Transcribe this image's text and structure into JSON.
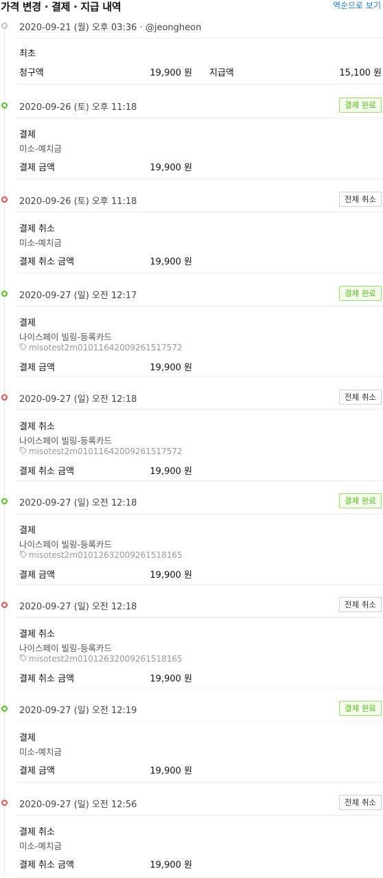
{
  "header": {
    "title": "가격 변경 · 결제 · 지급 내역",
    "reverse_label": "역순으로 보기"
  },
  "events": [
    {
      "status": "neutral",
      "date": "2020-09-21 (월) 오후 03:36 · @jeongheon",
      "type": "최초",
      "charge_label": "청구액",
      "charge_value": "19,900 원",
      "paid_label": "지급액",
      "paid_value": "15,100 원"
    },
    {
      "status": "success",
      "date": "2020-09-26 (토) 오후 11:18",
      "badge": "결제 완료",
      "type": "결제",
      "method": "미소-예치금",
      "amount_label": "결제 금액",
      "amount_value": "19,900 원"
    },
    {
      "status": "cancel",
      "date": "2020-09-26 (토) 오후 11:18",
      "badge": "전체 취소",
      "type": "결제 취소",
      "method": "미소-예치금",
      "amount_label": "결제 취소 금액",
      "amount_value": "19,900 원"
    },
    {
      "status": "success",
      "date": "2020-09-27 (일) 오전 12:17",
      "badge": "결제 완료",
      "type": "결제",
      "method": "나이스페이 빌링-등록카드",
      "tid": "misotest2m01011642009261517572",
      "amount_label": "결제 금액",
      "amount_value": "19,900 원"
    },
    {
      "status": "cancel",
      "date": "2020-09-27 (일) 오전 12:18",
      "badge": "전체 취소",
      "type": "결제 취소",
      "method": "나이스페이 빌링-등록카드",
      "tid": "misotest2m01011642009261517572",
      "amount_label": "결제 취소 금액",
      "amount_value": "19,900 원"
    },
    {
      "status": "success",
      "date": "2020-09-27 (일) 오전 12:18",
      "badge": "결제 완료",
      "type": "결제",
      "method": "나이스페이 빌링-등록카드",
      "tid": "misotest2m01012632009261518165",
      "amount_label": "결제 금액",
      "amount_value": "19,900 원"
    },
    {
      "status": "cancel",
      "date": "2020-09-27 (일) 오전 12:18",
      "badge": "전체 취소",
      "type": "결제 취소",
      "method": "나이스페이 빌링-등록카드",
      "tid": "misotest2m01012632009261518165",
      "amount_label": "결제 취소 금액",
      "amount_value": "19,900 원"
    },
    {
      "status": "success",
      "date": "2020-09-27 (일) 오전 12:19",
      "badge": "결제 완료",
      "type": "결제",
      "method": "미소-예치금",
      "amount_label": "결제 금액",
      "amount_value": "19,900 원"
    },
    {
      "status": "cancel",
      "date": "2020-09-27 (일) 오전 12:56",
      "badge": "전체 취소",
      "type": "결제 취소",
      "method": "미소-예치금",
      "amount_label": "결제 취소 금액",
      "amount_value": "19,900 원"
    }
  ],
  "colors": {
    "link": "#1a73e8",
    "success": "#52c41a",
    "cancel": "#e84b4b",
    "neutral": "#c2c2c2"
  },
  "icons": {
    "transaction_id": "tag-icon"
  }
}
